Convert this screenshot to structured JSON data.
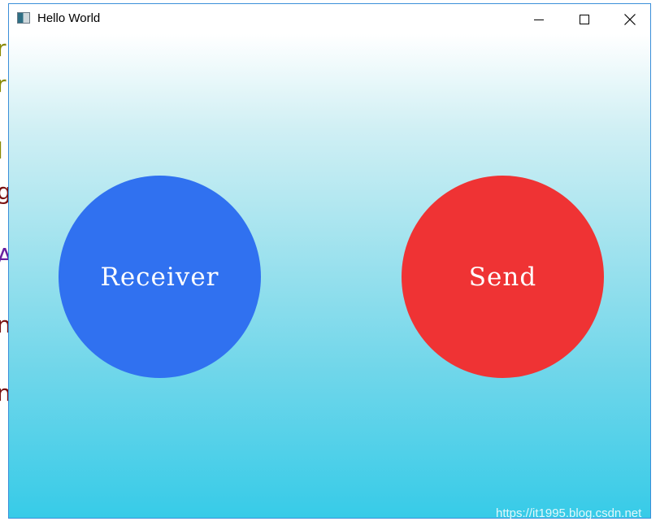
{
  "window": {
    "title": "Hello World",
    "icon": "app-window-icon",
    "controls": {
      "minimize": "minimize-icon",
      "maximize": "maximize-icon",
      "close": "close-icon"
    }
  },
  "background_fragments": [
    {
      "text": "r",
      "color": "#8a8a00"
    },
    {
      "text": "r",
      "color": "#8a8a00"
    },
    {
      "text": "l",
      "color": "#8a8a00"
    },
    {
      "text": "g",
      "color": "#7a1010"
    },
    {
      "text": "A",
      "color": "#6a1fa0"
    },
    {
      "text": "n",
      "color": "#7a1010"
    },
    {
      "text": "n",
      "color": "#7a1010"
    }
  ],
  "buttons": {
    "receiver": {
      "label": "Receiver",
      "color": "#3071f0"
    },
    "send": {
      "label": "Send",
      "color": "#ef3334"
    }
  },
  "colors": {
    "gradient_top": "#ffffff",
    "gradient_bottom": "#37cbe8",
    "window_border": "#3b8fd9"
  },
  "watermark": "https://it1995.blog.csdn.net"
}
